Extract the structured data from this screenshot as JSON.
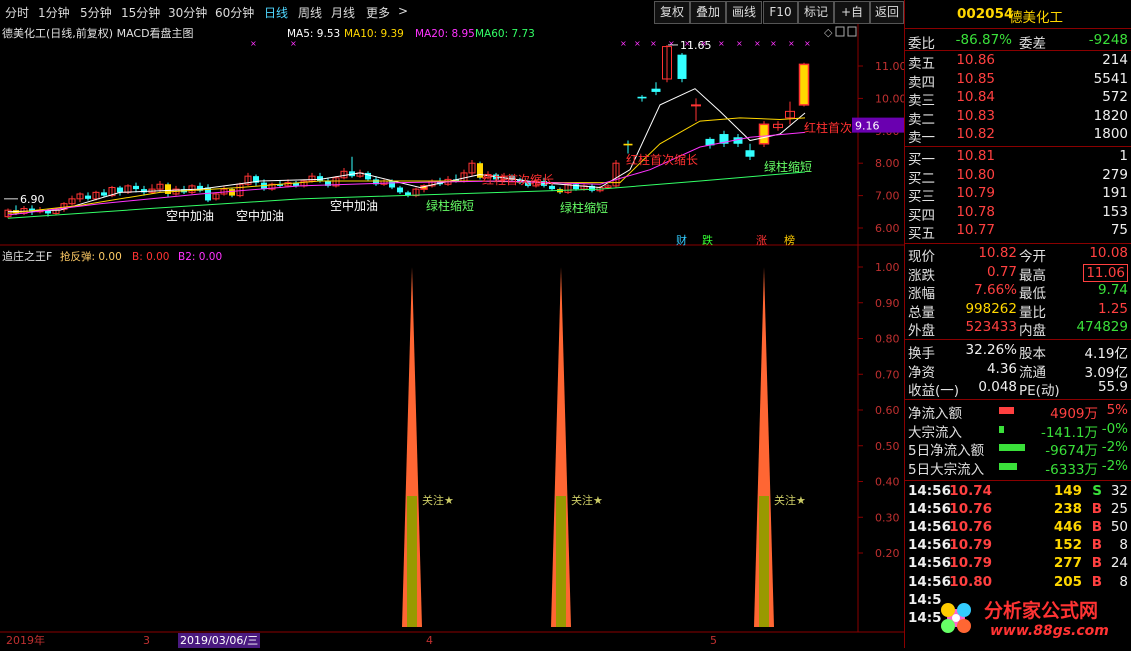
{
  "toolbar": {
    "periods": [
      "分时",
      "1分钟",
      "5分钟",
      "15分钟",
      "30分钟",
      "60分钟",
      "日线",
      "周线",
      "月线",
      "更多"
    ],
    "active_period": "日线",
    "buttons": [
      "复权",
      "叠加",
      "画线",
      "F10",
      "标记",
      "+自选",
      "返回"
    ]
  },
  "main_chart": {
    "title": "德美化工(日线,前复权) MACD看盘主图",
    "ma": [
      {
        "label": "MA5: 9.53",
        "color": "#ffffff"
      },
      {
        "label": "MA10: 9.39",
        "color": "#ffd700"
      },
      {
        "label": "MA20: 8.95",
        "color": "#ff33ff"
      },
      {
        "label": "MA60: 7.73",
        "color": "#33ff66"
      }
    ],
    "y_ticks": [
      "11.00",
      "10.00",
      "9.00",
      "8.00",
      "7.00",
      "6.00"
    ],
    "price_marker": "9.16",
    "high_label": "11.65",
    "low_label": "6.90",
    "annotations": [
      {
        "text": "空中加油",
        "color": "#ffffff"
      },
      {
        "text": "空中加油",
        "color": "#ffffff"
      },
      {
        "text": "空中加油",
        "color": "#ffffff"
      },
      {
        "text": "绿柱缩短",
        "color": "#66ff66"
      },
      {
        "text": "红柱首次缩长",
        "color": "#ff3030"
      },
      {
        "text": "绿柱缩短",
        "color": "#66ff66"
      },
      {
        "text": "红柱首次缩长",
        "color": "#ff3030"
      },
      {
        "text": "绿柱缩短",
        "color": "#66ff66"
      },
      {
        "text": "红柱首次",
        "color": "#ff3030"
      }
    ],
    "badges": [
      {
        "text": "财",
        "color": "#33ccff"
      },
      {
        "text": "跌",
        "color": "#33ff33"
      },
      {
        "text": "涨",
        "color": "#ff3333"
      },
      {
        "text": "榜",
        "color": "#ffcc00"
      }
    ]
  },
  "indicator": {
    "title": "追庄之王F",
    "values": [
      {
        "label": "抢反弹: 0.00",
        "color": "#ffcc66"
      },
      {
        "label": "B: 0.00",
        "color": "#ff3333"
      },
      {
        "label": "B2: 0.00",
        "color": "#ff33ff"
      }
    ],
    "y_ticks": [
      "1.00",
      "0.90",
      "0.80",
      "0.70",
      "0.60",
      "0.50",
      "0.40",
      "0.30",
      "0.20"
    ],
    "signal_label": "关注★",
    "signal_count": 3
  },
  "date_axis": {
    "labels": [
      "2019年",
      "3",
      "2019/03/06/三",
      "4",
      "5"
    ]
  },
  "quote": {
    "code": "002054",
    "name": "德美化工",
    "weibi_label": "委比",
    "weibi": "-86.87%",
    "weicha_label": "委差",
    "weicha": "-9248",
    "asks": [
      {
        "label": "卖五",
        "price": "10.86",
        "vol": "214"
      },
      {
        "label": "卖四",
        "price": "10.85",
        "vol": "5541"
      },
      {
        "label": "卖三",
        "price": "10.84",
        "vol": "572"
      },
      {
        "label": "卖二",
        "price": "10.83",
        "vol": "1820"
      },
      {
        "label": "卖一",
        "price": "10.82",
        "vol": "1800"
      }
    ],
    "bids": [
      {
        "label": "买一",
        "price": "10.81",
        "vol": "1"
      },
      {
        "label": "买二",
        "price": "10.80",
        "vol": "279"
      },
      {
        "label": "买三",
        "price": "10.79",
        "vol": "191"
      },
      {
        "label": "买四",
        "price": "10.78",
        "vol": "153"
      },
      {
        "label": "买五",
        "price": "10.77",
        "vol": "75"
      }
    ],
    "stats": [
      {
        "l1": "现价",
        "v1": "10.82",
        "c1": "red",
        "l2": "今开",
        "v2": "10.08",
        "c2": "red"
      },
      {
        "l1": "涨跌",
        "v1": "0.77",
        "c1": "red",
        "l2": "最高",
        "v2": "11.06",
        "c2": "red"
      },
      {
        "l1": "涨幅",
        "v1": "7.66%",
        "c1": "red",
        "l2": "最低",
        "v2": "9.74",
        "c2": "grn"
      },
      {
        "l1": "总量",
        "v1": "998262",
        "c1": "yel",
        "l2": "量比",
        "v2": "1.25",
        "c2": "red"
      },
      {
        "l1": "外盘",
        "v1": "523433",
        "c1": "red",
        "l2": "内盘",
        "v2": "474829",
        "c2": "grn"
      }
    ],
    "stats2": [
      {
        "l1": "换手",
        "v1": "32.26%",
        "l2": "股本",
        "v2": "4.19亿"
      },
      {
        "l1": "净资",
        "v1": "4.36",
        "l2": "流通",
        "v2": "3.09亿"
      },
      {
        "l1": "收益(一)",
        "v1": "0.048",
        "l2": "PE(动)",
        "v2": "55.9"
      }
    ],
    "flows": [
      {
        "label": "净流入额",
        "value": "4909万",
        "pct": "5%",
        "color": "#ff4040",
        "bar": 0.5,
        "vc": "red"
      },
      {
        "label": "大宗流入",
        "value": "-141.1万",
        "pct": "-0%",
        "color": "#3ae03a",
        "bar": 0.05,
        "vc": "grn"
      },
      {
        "label": "5日净流入额",
        "value": "-9674万",
        "pct": "-2%",
        "color": "#3ae03a",
        "bar": 1.0,
        "vc": "grn"
      },
      {
        "label": "5日大宗流入",
        "value": "-6333万",
        "pct": "-2%",
        "color": "#3ae03a",
        "bar": 0.65,
        "vc": "grn"
      }
    ],
    "ticks": [
      {
        "time": "14:56",
        "price": "10.74",
        "vol": "149",
        "bs": "S",
        "n": "32"
      },
      {
        "time": "14:56",
        "price": "10.76",
        "vol": "238",
        "bs": "B",
        "n": "25"
      },
      {
        "time": "14:56",
        "price": "10.76",
        "vol": "446",
        "bs": "B",
        "n": "50"
      },
      {
        "time": "14:56",
        "price": "10.79",
        "vol": "152",
        "bs": "B",
        "n": "8"
      },
      {
        "time": "14:56",
        "price": "10.79",
        "vol": "277",
        "bs": "B",
        "n": "24"
      },
      {
        "time": "14:56",
        "price": "10.80",
        "vol": "205",
        "bs": "B",
        "n": "8"
      },
      {
        "time": "14:5",
        "price": "",
        "vol": "",
        "bs": "",
        "n": ""
      },
      {
        "time": "14:5",
        "price": "",
        "vol": "",
        "bs": "",
        "n": ""
      }
    ]
  },
  "watermark": {
    "title": "分析家公式网",
    "url": "www.88gs.com"
  }
}
